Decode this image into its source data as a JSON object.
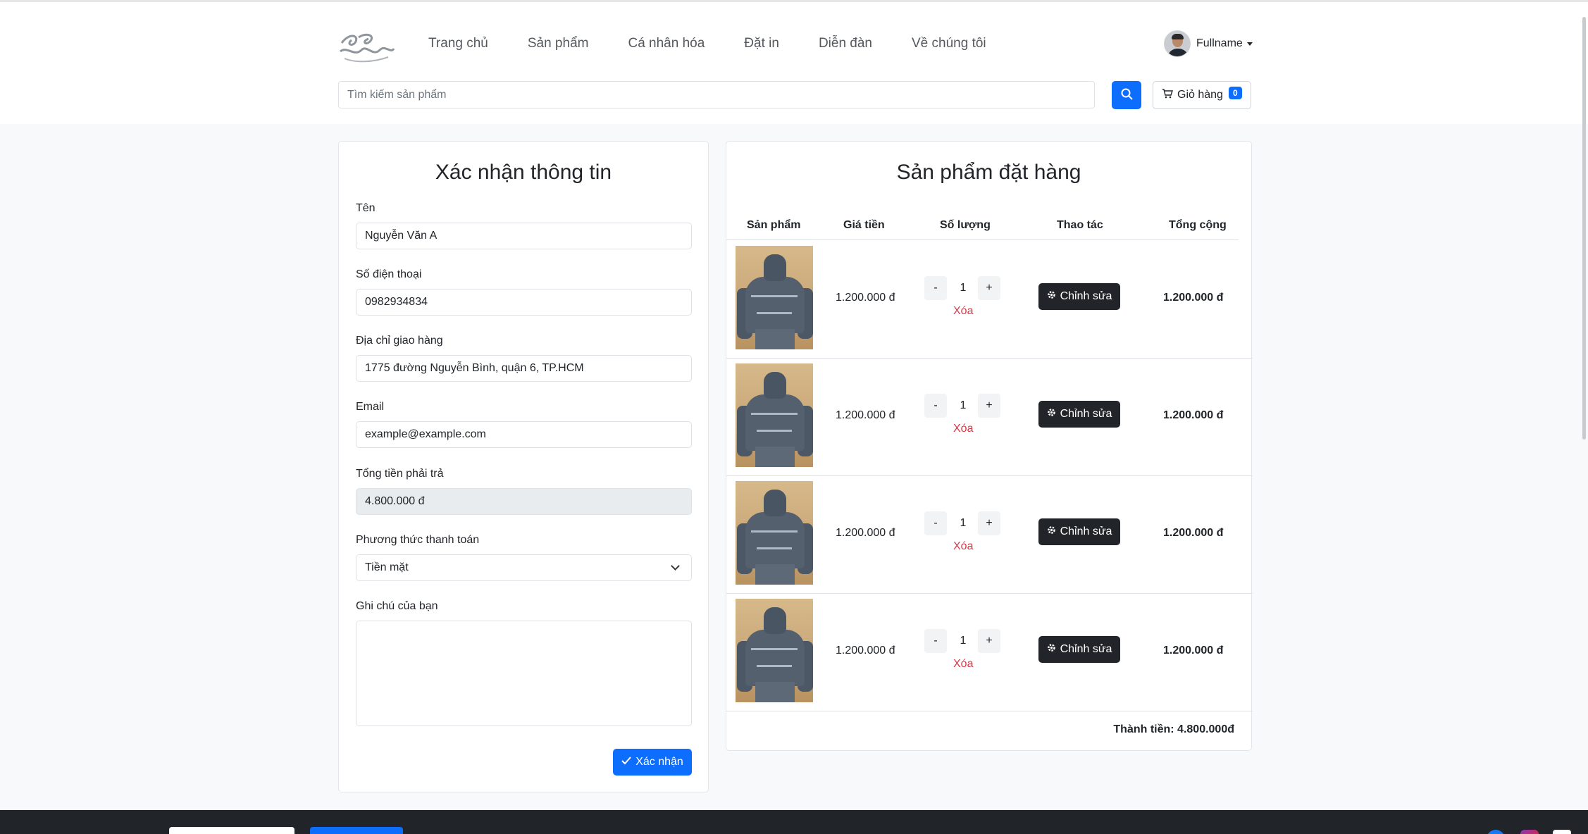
{
  "nav": {
    "items": [
      "Trang chủ",
      "Sản phẩm",
      "Cá nhân hóa",
      "Đặt in",
      "Diễn đàn",
      "Về chúng tôi"
    ],
    "user_name": "Fullname"
  },
  "search": {
    "placeholder": "Tìm kiếm sản phẩm"
  },
  "cart": {
    "label": "Giỏ hàng",
    "count": "0"
  },
  "form": {
    "title": "Xác nhận thông tin",
    "name_label": "Tên",
    "name_value": "Nguyễn Văn A",
    "phone_label": "Số điện thoại",
    "phone_value": "0982934834",
    "address_label": "Địa chỉ giao hàng",
    "address_value": "1775 đường Nguyễn Bình, quận 6, TP.HCM",
    "email_label": "Email",
    "email_value": "example@example.com",
    "total_label": "Tổng tiền phải trả",
    "total_value": "4.800.000 đ",
    "payment_label": "Phương thức thanh toán",
    "payment_value": "Tiền mặt",
    "note_label": "Ghi chú của bạn",
    "note_value": "",
    "confirm_label": "Xác nhận"
  },
  "order": {
    "title": "Sản phẩm đặt hàng",
    "columns": [
      "Sản phẩm",
      "Giá tiền",
      "Số lượng",
      "Thao tác",
      "Tổng cộng"
    ],
    "rows": [
      {
        "price": "1.200.000 đ",
        "qty": "1",
        "minus": "-",
        "plus": "+",
        "remove": "Xóa",
        "edit": "Chỉnh sửa",
        "total": "1.200.000 đ"
      },
      {
        "price": "1.200.000 đ",
        "qty": "1",
        "minus": "-",
        "plus": "+",
        "remove": "Xóa",
        "edit": "Chỉnh sửa",
        "total": "1.200.000 đ"
      },
      {
        "price": "1.200.000 đ",
        "qty": "1",
        "minus": "-",
        "plus": "+",
        "remove": "Xóa",
        "edit": "Chỉnh sửa",
        "total": "1.200.000 đ"
      },
      {
        "price": "1.200.000 đ",
        "qty": "1",
        "minus": "-",
        "plus": "+",
        "remove": "Xóa",
        "edit": "Chỉnh sửa",
        "total": "1.200.000 đ"
      }
    ],
    "grand_total": "Thành tiền: 4.800.000đ"
  },
  "icons": {
    "search": "search-icon",
    "cart": "cart-icon",
    "gear": "gear-icon",
    "check": "check-icon",
    "chevron": "chevron-down-icon"
  },
  "colors": {
    "primary": "#0d6efd",
    "dark": "#212529",
    "danger": "#dc3545",
    "page_bg": "#f8f9fa"
  }
}
